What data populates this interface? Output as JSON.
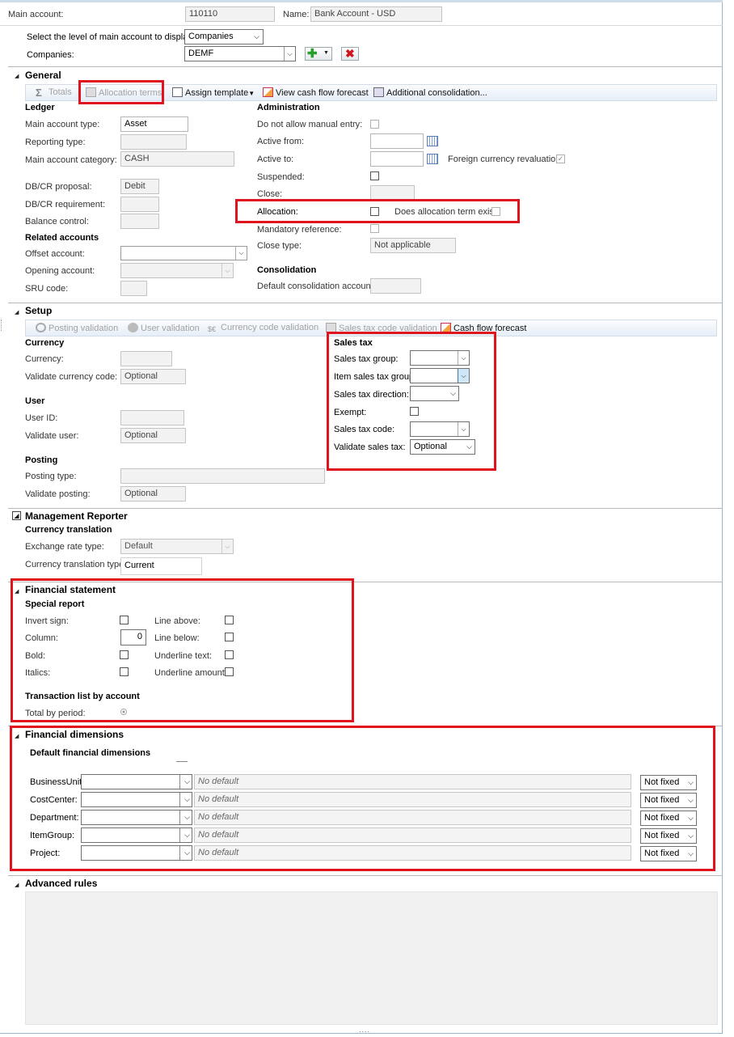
{
  "header": {
    "main_account_label": "Main account:",
    "main_account_value": "110110",
    "name_label": "Name:",
    "name_value": "Bank Account - USD",
    "level_label": "Select the level of main account to display:",
    "level_value": "Companies",
    "companies_label": "Companies:",
    "companies_value": "DEMF"
  },
  "general": {
    "title": "General",
    "toolbar": {
      "totals": "Totals",
      "allocation_terms": "Allocation terms",
      "assign_template": "Assign template",
      "view_cash_flow": "View cash flow forecast",
      "additional_consolidation": "Additional consolidation..."
    },
    "ledger": {
      "title": "Ledger",
      "main_account_type_label": "Main account type:",
      "main_account_type_value": "Asset",
      "reporting_type_label": "Reporting type:",
      "main_account_category_label": "Main account category:",
      "main_account_category_value": "CASH",
      "dbcr_proposal_label": "DB/CR proposal:",
      "dbcr_proposal_value": "Debit",
      "dbcr_requirement_label": "DB/CR requirement:",
      "balance_control_label": "Balance control:"
    },
    "related": {
      "title": "Related accounts",
      "offset_label": "Offset account:",
      "opening_label": "Opening account:",
      "sru_label": "SRU code:"
    },
    "admin": {
      "title": "Administration",
      "no_manual_label": "Do not allow manual entry:",
      "active_from_label": "Active from:",
      "active_to_label": "Active to:",
      "fx_reval_label": "Foreign currency revaluation:",
      "suspended_label": "Suspended:",
      "close_label": "Close:",
      "allocation_label": "Allocation:",
      "alloc_term_exist_label": "Does allocation term exist:",
      "mandatory_ref_label": "Mandatory reference:",
      "close_type_label": "Close type:",
      "close_type_value": "Not applicable"
    },
    "consolidation": {
      "title": "Consolidation",
      "default_label": "Default consolidation account:"
    }
  },
  "setup": {
    "title": "Setup",
    "toolbar": {
      "posting_validation": "Posting validation",
      "user_validation": "User validation",
      "currency_validation": "Currency code validation",
      "salestax_validation": "Sales tax code validation",
      "cash_flow": "Cash flow forecast"
    },
    "currency": {
      "title": "Currency",
      "currency_label": "Currency:",
      "validate_label": "Validate currency code:",
      "validate_value": "Optional"
    },
    "user": {
      "title": "User",
      "user_id_label": "User ID:",
      "validate_label": "Validate user:",
      "validate_value": "Optional"
    },
    "posting": {
      "title": "Posting",
      "type_label": "Posting type:",
      "validate_label": "Validate posting:",
      "validate_value": "Optional"
    },
    "salestax": {
      "title": "Sales tax",
      "group_label": "Sales tax group:",
      "item_group_label": "Item sales tax group:",
      "direction_label": "Sales tax direction:",
      "exempt_label": "Exempt:",
      "code_label": "Sales tax code:",
      "validate_label": "Validate sales tax:",
      "validate_value": "Optional"
    }
  },
  "mgmt": {
    "title": "Management Reporter",
    "currency_translation_title": "Currency translation",
    "exchange_rate_label": "Exchange rate type:",
    "exchange_rate_value": "Default",
    "translation_type_label": "Currency translation type:",
    "translation_type_value": "Current"
  },
  "finstatement": {
    "title": "Financial statement",
    "special_report_title": "Special report",
    "invert_sign_label": "Invert sign:",
    "column_label": "Column:",
    "column_value": "0",
    "bold_label": "Bold:",
    "italics_label": "Italics:",
    "line_above_label": "Line above:",
    "line_below_label": "Line below:",
    "underline_text_label": "Underline text:",
    "underline_amount_label": "Underline amount:",
    "translist_title": "Transaction list by account",
    "total_by_period_label": "Total by period:"
  },
  "findims": {
    "title": "Financial dimensions",
    "subtitle": "Default financial dimensions",
    "rows": [
      {
        "label": "BusinessUnit:",
        "value": "No default",
        "fixed": "Not fixed"
      },
      {
        "label": "CostCenter:",
        "value": "No default",
        "fixed": "Not fixed"
      },
      {
        "label": "Department:",
        "value": "No default",
        "fixed": "Not fixed"
      },
      {
        "label": "ItemGroup:",
        "value": "No default",
        "fixed": "Not fixed"
      },
      {
        "label": "Project:",
        "value": "No default",
        "fixed": "Not fixed"
      }
    ]
  },
  "advanced": {
    "title": "Advanced rules"
  },
  "footer": {
    "grip": "...."
  },
  "colors": {
    "highlight": "#e0141e",
    "toolbar_bg": "#e6eef8"
  }
}
